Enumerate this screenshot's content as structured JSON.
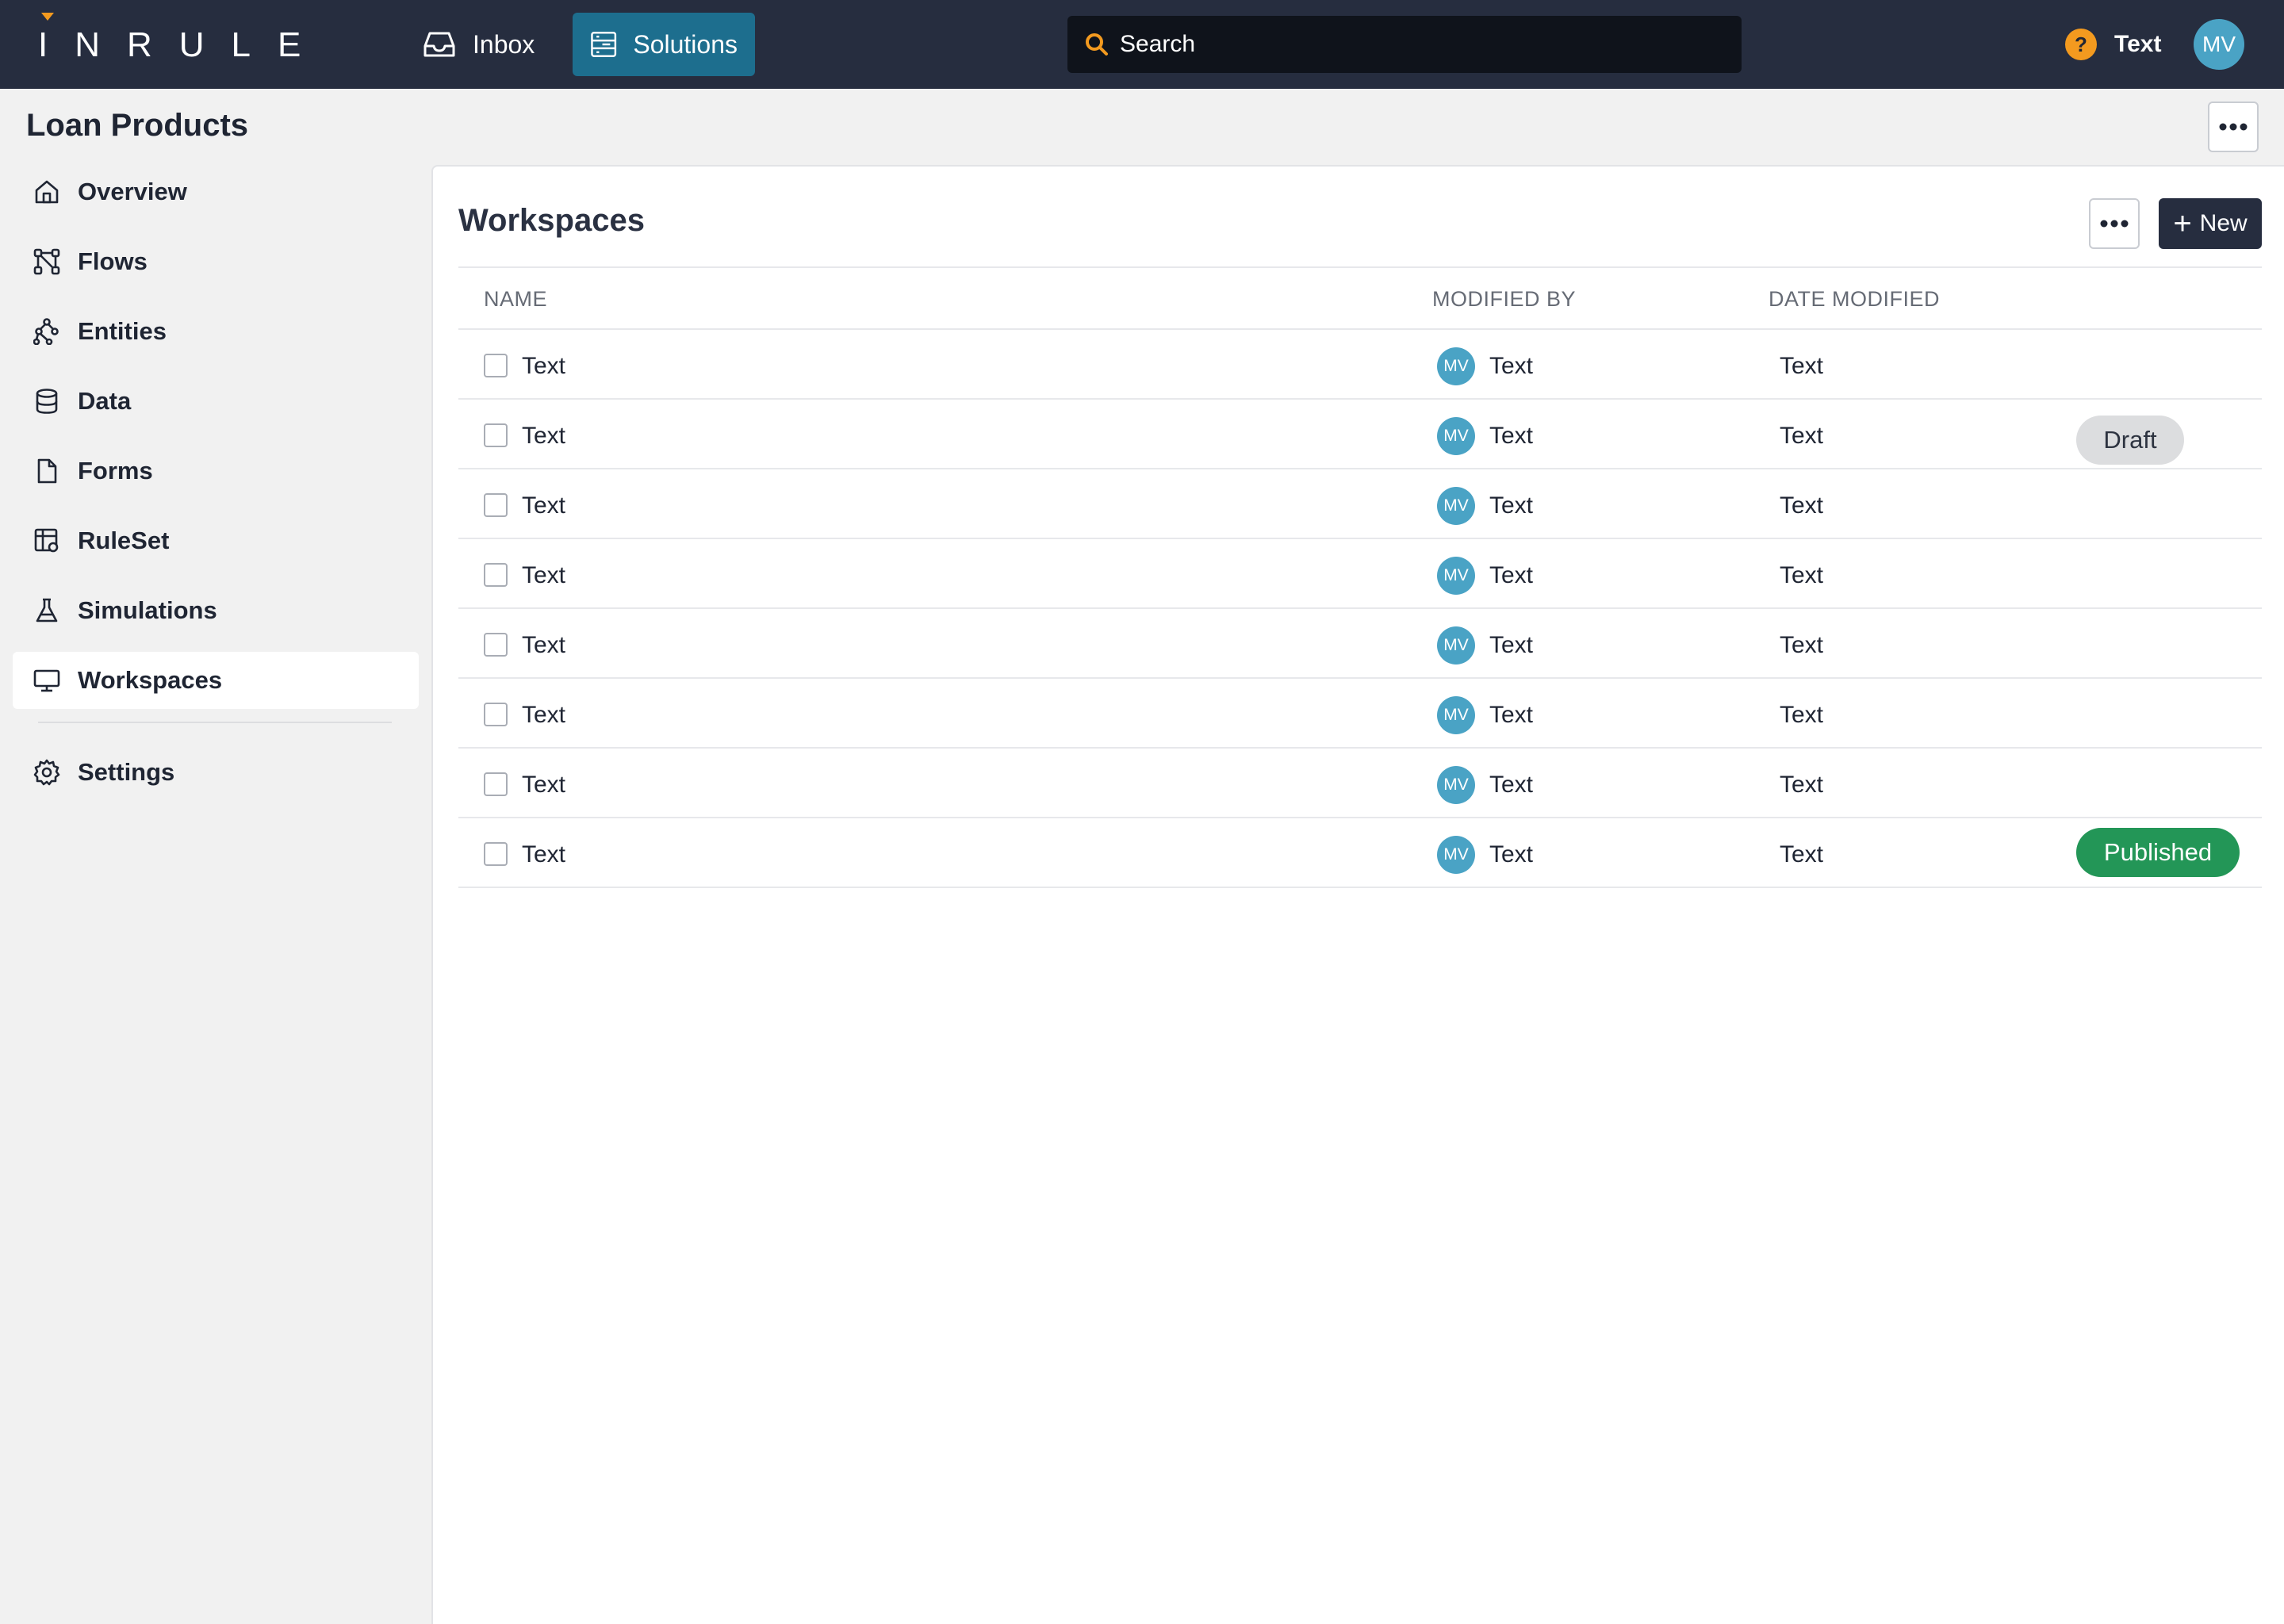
{
  "header": {
    "logo_text": "INRULE",
    "nav": [
      {
        "label": "Inbox",
        "icon": "inbox-icon"
      },
      {
        "label": "Solutions",
        "icon": "solutions-icon"
      }
    ],
    "search_placeholder": "Search",
    "help_label": "Text",
    "user_initials": "MV",
    "colors": {
      "bar": "#262d3f",
      "accent": "#1d6e8e",
      "help": "#f39a1f"
    }
  },
  "project": {
    "title": "Loan Products"
  },
  "sidebar": {
    "items": [
      {
        "label": "Overview",
        "icon": "home-icon"
      },
      {
        "label": "Flows",
        "icon": "flow-icon"
      },
      {
        "label": "Entities",
        "icon": "entities-icon"
      },
      {
        "label": "Data",
        "icon": "database-icon"
      },
      {
        "label": "Forms",
        "icon": "document-icon"
      },
      {
        "label": "RuleSet",
        "icon": "ruleset-icon"
      },
      {
        "label": "Simulations",
        "icon": "flask-icon"
      },
      {
        "label": "Workspaces",
        "icon": "monitor-icon",
        "active": true
      }
    ],
    "settings": {
      "label": "Settings",
      "icon": "gear-icon"
    }
  },
  "main": {
    "title": "Workspaces",
    "new_label": "New",
    "columns": [
      "NAME",
      "MODIFIED BY",
      "DATE MODIFIED"
    ],
    "rows": [
      {
        "name": "Text",
        "initials": "MV",
        "modified_by": "Text",
        "date": "Text",
        "status": ""
      },
      {
        "name": "Text",
        "initials": "MV",
        "modified_by": "Text",
        "date": "Text",
        "status": "Draft"
      },
      {
        "name": "Text",
        "initials": "MV",
        "modified_by": "Text",
        "date": "Text",
        "status": ""
      },
      {
        "name": "Text",
        "initials": "MV",
        "modified_by": "Text",
        "date": "Text",
        "status": ""
      },
      {
        "name": "Text",
        "initials": "MV",
        "modified_by": "Text",
        "date": "Text",
        "status": ""
      },
      {
        "name": "Text",
        "initials": "MV",
        "modified_by": "Text",
        "date": "Text",
        "status": ""
      },
      {
        "name": "Text",
        "initials": "MV",
        "modified_by": "Text",
        "date": "Text",
        "status": ""
      },
      {
        "name": "Text",
        "initials": "MV",
        "modified_by": "Text",
        "date": "Text",
        "status": "Published"
      }
    ],
    "status_colors": {
      "Draft": "#dcdddf",
      "Published": "#239657"
    }
  }
}
